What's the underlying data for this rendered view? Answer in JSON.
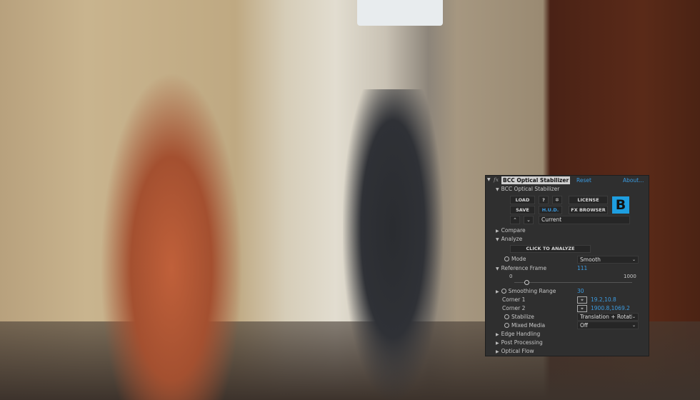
{
  "panel": {
    "fx_label": "fx",
    "effect_name": "BCC Optical Stabilizer",
    "reset": "Reset",
    "about": "About...",
    "group_title": "BCC Optical Stabilizer",
    "buttons": {
      "load": "LOAD",
      "help": "?",
      "settings_icon": "gear-icon",
      "license": "LICENSE",
      "save": "SAVE",
      "hud": "H.U.D.",
      "fx_browser": "FX BROWSER",
      "up": "^",
      "down": "v",
      "logo": "B"
    },
    "preset": "Current",
    "sections": {
      "compare": "Compare",
      "analyze": "Analyze",
      "edge_handling": "Edge Handling",
      "post_processing": "Post Processing",
      "optical_flow": "Optical Flow"
    },
    "analyze_button": "CLICK TO ANALYZE",
    "mode": {
      "label": "Mode",
      "value": "Smooth"
    },
    "reference_frame": {
      "label": "Reference Frame",
      "value": "111",
      "min": "0",
      "max": "1000",
      "slider_fraction": 0.111
    },
    "smoothing_range": {
      "label": "Smoothing Range",
      "value": "30"
    },
    "corner1": {
      "label": "Corner 1",
      "value": "19.2,10.8"
    },
    "corner2": {
      "label": "Corner 2",
      "value": "1900.8,1069.2"
    },
    "stabilize": {
      "label": "Stabilize",
      "value": "Translation + Rotatic"
    },
    "mixed_media": {
      "label": "Mixed Media",
      "value": "Off"
    },
    "accent": "#3b9be0"
  }
}
